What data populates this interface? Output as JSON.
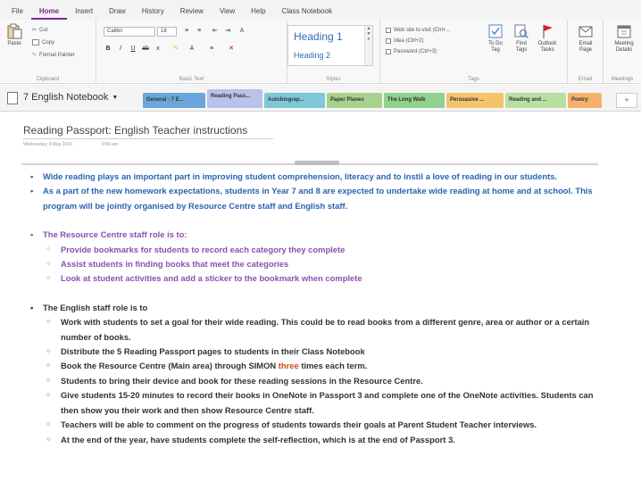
{
  "menu": {
    "tabs": [
      "File",
      "Home",
      "Insert",
      "Draw",
      "History",
      "Review",
      "View",
      "Help",
      "Class Notebook"
    ],
    "active_tab": "Home"
  },
  "ribbon": {
    "clipboard": {
      "paste": "Paste",
      "cut": "Cut",
      "copy": "Copy",
      "format_painter": "Format Painter",
      "label": "Clipboard"
    },
    "basic_text": {
      "font": "Calibri",
      "size": "18",
      "label": "Basic Text"
    },
    "styles": {
      "heading1": "Heading 1",
      "heading2": "Heading 2",
      "label": "Styles"
    },
    "tags": {
      "items": [
        "Web site to visit (Ctrl+...",
        "Idea (Ctrl+2)",
        "Password (Ctrl+3)"
      ],
      "todo": "To Do Tag",
      "find": "Find Tags",
      "outlook": "Outlook Tasks",
      "label": "Tags"
    },
    "email": {
      "button": "Email Page",
      "label": "Email"
    },
    "meetings": {
      "button": "Meeting Details",
      "label": "Meetings"
    }
  },
  "notebook": {
    "name": "7 English Notebook",
    "add_section": "+",
    "sections": [
      {
        "label": "General - 7 E...",
        "color": "#6aa7d8"
      },
      {
        "label": "Reading Pass...",
        "color": "#b9c2ea"
      },
      {
        "label": "Autobiograp...",
        "color": "#7fc8d8"
      },
      {
        "label": "Paper Planes",
        "color": "#a9d18e"
      },
      {
        "label": "The Long Walk",
        "color": "#8fd28f"
      },
      {
        "label": "Persuasive ...",
        "color": "#f4c46b"
      },
      {
        "label": "Reading and ...",
        "color": "#b8e0a0"
      },
      {
        "label": "Poetry",
        "color": "#f6b26b"
      }
    ],
    "active_section": "Reading Pass..."
  },
  "page": {
    "title": "Reading Passport: English Teacher instructions",
    "date": "Wednesday, 4 May 2016",
    "time": "9:56 am",
    "intro": [
      "Wide reading plays an important part in improving student  comprehension, literacy and to instil a love of reading in our students.",
      "As a part of the new homework expectations, students in Year 7 and 8 are expected to undertake wide reading at home and at school. This program will be jointly organised by Resource Centre staff and English staff."
    ],
    "resource_heading": "The Resource Centre staff role is to:",
    "resource_items": [
      "Provide bookmarks for students to record each category they complete",
      "Assist students in finding books that meet the categories",
      "Look at student activities and add a sticker to the bookmark when complete"
    ],
    "english_heading": "The English staff role is to",
    "english_items": [
      "Work with students to set a goal for their wide reading. This could be to read books from a different genre, area or author or a certain number of books.",
      "Distribute the 5 Reading Passport pages to students in their Class Notebook"
    ],
    "book_item": {
      "before": "Book the Resource Centre (Main area) through SIMON ",
      "highlight": "three",
      "after": " times each term."
    },
    "english_items_after": [
      "Students to bring their device and book for these reading sessions in the Resource Centre.",
      "Give students 15-20 minutes to record their books in OneNote in Passport 3 and complete one of the OneNote activities. Students can then show you their work and then show Resource Centre staff.",
      "Teachers will be able to comment on the progress of students towards their goals at Parent Student Teacher interviews.",
      "At the end of the year, have students complete the self-reflection, which is at the end of Passport 3."
    ]
  }
}
